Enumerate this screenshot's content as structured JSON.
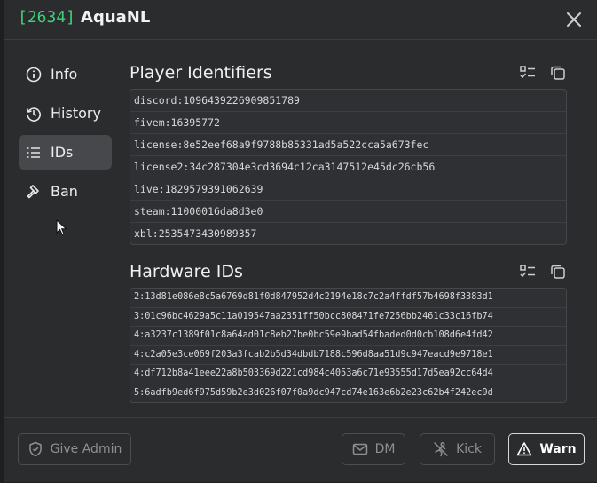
{
  "header": {
    "player_id": "[2634]",
    "player_name": "AquaNL"
  },
  "nav": {
    "items": [
      {
        "label": "Info",
        "icon": "info-icon"
      },
      {
        "label": "History",
        "icon": "history-icon"
      },
      {
        "label": "IDs",
        "icon": "list-icon",
        "active": true
      },
      {
        "label": "Ban",
        "icon": "gavel-icon"
      }
    ]
  },
  "player_identifiers": {
    "title": "Player Identifiers",
    "items": [
      "discord:1096439226909851789",
      "fivem:16395772",
      "license:8e52eef68a9f9788b85331ad5a522cca5a673fec",
      "license2:34c287304e3cd3694c12ca3147512e45dc26cb56",
      "live:1829579391062639",
      "steam:11000016da8d3e0",
      "xbl:2535473430989357"
    ]
  },
  "hardware_ids": {
    "title": "Hardware IDs",
    "items": [
      "2:13d81e086e8c5a6769d81f0d847952d4c2194e18c7c2a4ffdf57b4698f3383d1",
      "3:01c96bc4629a5c11a019547aa2351ff50bcc808471fe7256bb2461c33c16fb74",
      "4:a3237c1389f01c8a64ad01c8eb27be0bc59e9bad54fbaded0d0cb108d6e4fd42",
      "4:c2a05e3ce069f203a3fcab2b5d34dbdb7188c596d8aa51d9c947eacd9e9718e1",
      "4:df712b8a41eee22a8b503369d221cd984c4053a6c71e93555d17d5ea92cc64d4",
      "5:6adfb9ed6f975d59b2e3d026f07f0a9dc947cd74e163e6b2e23c62b4f242ec9d"
    ]
  },
  "footer": {
    "give_admin": "Give Admin",
    "dm": "DM",
    "kick": "Kick",
    "warn": "Warn"
  },
  "colors": {
    "accent_id": "#3fd07a",
    "background": "#2b2c2e"
  }
}
